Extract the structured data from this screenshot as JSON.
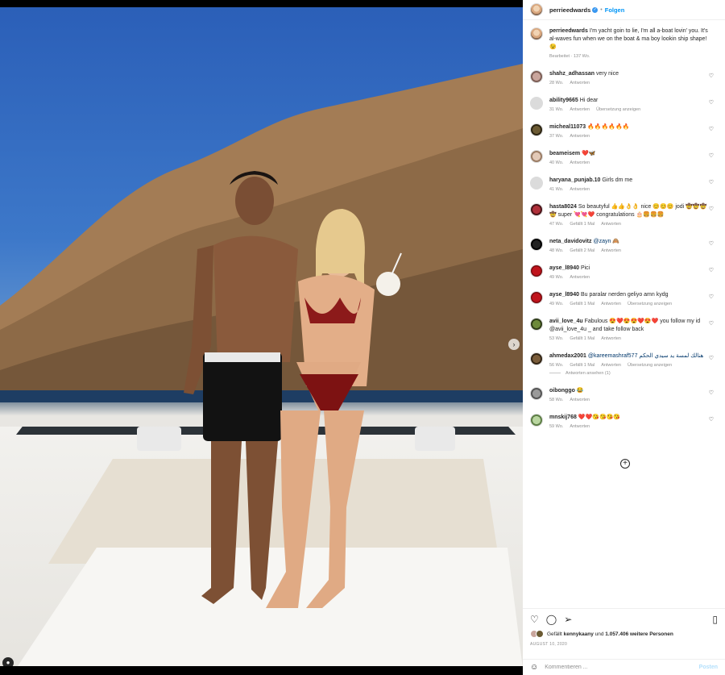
{
  "post": {
    "username": "perrieedwards",
    "follow_label": "Folgen",
    "caption": "I'm yacht goin to lie, I'm all a-boat lovin' you. It's al-waves fun when we on the boat & ma boy lookin ship shape! 😉",
    "caption_meta": "Bearbeitet · 137 Wo."
  },
  "comments": [
    {
      "user": "shahz_adhassan",
      "text": "very nice",
      "time": "28 Wo.",
      "likes": "",
      "reply": "Antworten",
      "translate": ""
    },
    {
      "user": "ability9665",
      "text": "Hi dear",
      "time": "31 Wo.",
      "likes": "",
      "reply": "Antworten",
      "translate": "Übersetzung anzeigen"
    },
    {
      "user": "micheal11073",
      "text": "🔥🔥🔥🔥🔥🔥",
      "time": "37 Wo.",
      "likes": "",
      "reply": "Antworten",
      "translate": ""
    },
    {
      "user": "beameisem",
      "text": "❤️🦋",
      "time": "40 Wo.",
      "likes": "",
      "reply": "Antworten",
      "translate": ""
    },
    {
      "user": "haryana_punjab.10",
      "text": "Girls dm me",
      "time": "41 Wo.",
      "likes": "",
      "reply": "Antworten",
      "translate": ""
    },
    {
      "user": "hasta8024",
      "text": "So beautyful 👍👍👌👌 nice 😊😊😊 jodi 🤠🤠🤠🤠 super 💘💘❤️ congratulations 🎂🍔🍔🍔",
      "time": "47 Wo.",
      "likes": "Gefällt 1 Mal",
      "reply": "Antworten",
      "translate": ""
    },
    {
      "user": "neta_davidovitz",
      "text": "@zayn 🙈",
      "time": "48 Wo.",
      "likes": "Gefällt 2 Mal",
      "reply": "Antworten",
      "translate": ""
    },
    {
      "user": "ayse_l8940",
      "text": "Pici",
      "time": "49 Wo.",
      "likes": "",
      "reply": "Antworten",
      "translate": ""
    },
    {
      "user": "ayse_l8940",
      "text": "Bu paralar nerden geliyo amn kydg",
      "time": "49 Wo.",
      "likes": "Gefällt 1 Mal",
      "reply": "Antworten",
      "translate": "Übersetzung anzeigen"
    },
    {
      "user": "avii_love_4u",
      "text": "Fabulous 😍❤️😍😍❤️😍❤️ you follow my id @avii_love_4u _ and take follow back",
      "time": "53 Wo.",
      "likes": "Gefällt 1 Mal",
      "reply": "Antworten",
      "translate": ""
    },
    {
      "user": "ahmedax2001",
      "text": "@kareemashraf577 هنالك لمسة يد سيدي الحكم",
      "time": "56 Wo.",
      "likes": "Gefällt 1 Mal",
      "reply": "Antworten",
      "translate": "Übersetzung anzeigen",
      "replies_label": "Antworten ansehen (1)"
    },
    {
      "user": "oibonggo",
      "text": "😂",
      "time": "58 Wo.",
      "likes": "",
      "reply": "Antworten",
      "translate": ""
    },
    {
      "user": "mnskij768",
      "text": "❤️❤️😘😘😘😘",
      "time": "59 Wo.",
      "likes": "",
      "reply": "Antworten",
      "translate": ""
    }
  ],
  "footer": {
    "likes_prefix": "Gefällt ",
    "likes_user": "kennykaany",
    "likes_middle": " und ",
    "likes_count": "1.057.406 weitere Personen",
    "date": "AUGUST 10, 2020",
    "comment_placeholder": "Kommentieren ...",
    "post_label": "Posten"
  },
  "icons": {
    "heart": "heart-icon",
    "comment": "comment-icon",
    "share": "share-icon",
    "save": "bookmark-icon",
    "emoji": "emoji-icon",
    "load_more": "plus-circle-icon",
    "next": "chevron-right-icon",
    "user_tag": "user-tag-icon"
  },
  "colors": {
    "link": "#0095f6",
    "mention": "#00376b",
    "muted": "#8e8e8e",
    "post_disabled": "#b2dffc"
  }
}
